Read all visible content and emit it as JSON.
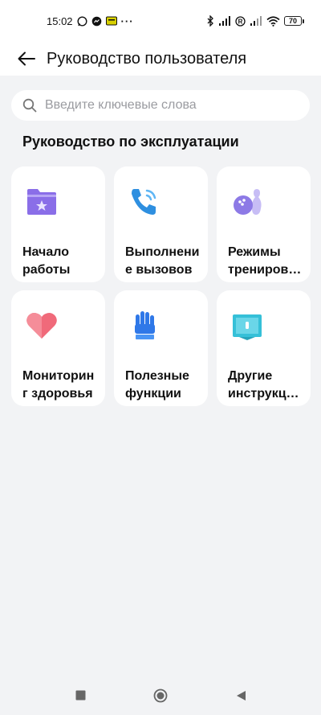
{
  "status_bar": {
    "time": "15:02",
    "battery": "70",
    "dots": "···"
  },
  "app_bar": {
    "title": "Руководство пользователя"
  },
  "search": {
    "placeholder": "Введите ключевые слова"
  },
  "section": {
    "title": "Руководство по эксплуатации"
  },
  "cards": [
    {
      "label": "Начало\nработы",
      "icon": "folder-star-icon"
    },
    {
      "label": "Выполнени\nе вызовов",
      "icon": "phone-call-icon"
    },
    {
      "label": "Режимы\nтрениров…",
      "icon": "bowling-icon"
    },
    {
      "label": "Мониторин\nг здоровья",
      "icon": "heart-icon"
    },
    {
      "label": "Полезные\nфункции",
      "icon": "glove-icon"
    },
    {
      "label": "Другие\nинструкц…",
      "icon": "book-icon"
    }
  ],
  "colors": {
    "background": "#f2f3f5",
    "card": "#ffffff",
    "folder": "#8a6ee8",
    "phone": "#2e8fe0",
    "bowling": "#8d7ae6",
    "heart": "#f06a7a",
    "glove": "#2f78e8",
    "book": "#35c0d8"
  }
}
